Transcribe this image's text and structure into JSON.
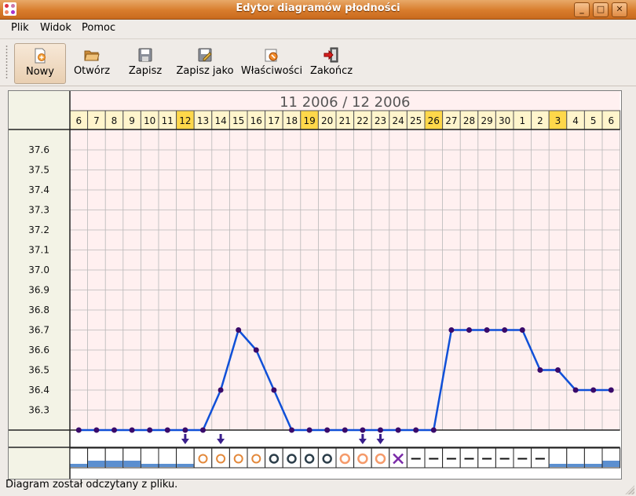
{
  "window": {
    "title": "Edytor diagramów płodności",
    "minimize_glyph": "_",
    "maximize_glyph": "□",
    "close_glyph": "✕"
  },
  "menubar": {
    "items": [
      {
        "label": "Plik"
      },
      {
        "label": "Widok"
      },
      {
        "label": "Pomoc"
      }
    ]
  },
  "toolbar": {
    "buttons": [
      {
        "label": "Nowy",
        "icon": "new-document-icon",
        "active": true
      },
      {
        "label": "Otwórz",
        "icon": "folder-open-icon"
      },
      {
        "label": "Zapisz",
        "icon": "floppy-disk-icon"
      },
      {
        "label": "Zapisz jako",
        "icon": "save-as-icon"
      },
      {
        "label": "Właściwości",
        "icon": "properties-icon"
      },
      {
        "label": "Zakończ",
        "icon": "exit-icon"
      }
    ]
  },
  "chart_data": {
    "type": "line",
    "title": "11 2006 / 12 2006",
    "x": [
      "6",
      "7",
      "8",
      "9",
      "10",
      "11",
      "12",
      "13",
      "14",
      "15",
      "16",
      "17",
      "18",
      "19",
      "20",
      "21",
      "22",
      "23",
      "24",
      "25",
      "26",
      "27",
      "28",
      "29",
      "30",
      "1",
      "2",
      "3",
      "4",
      "5",
      "6"
    ],
    "highlighted_days": [
      6,
      13,
      20,
      27
    ],
    "y_ticks": [
      "37.6",
      "37.5",
      "37.4",
      "37.3",
      "37.2",
      "37.1",
      "37.0",
      "36.9",
      "36.8",
      "36.7",
      "36.6",
      "36.5",
      "36.4",
      "36.3"
    ],
    "ylim": [
      36.2,
      37.7
    ],
    "series": [
      {
        "values": [
          36.2,
          36.2,
          36.2,
          36.2,
          36.2,
          36.2,
          36.2,
          36.2,
          36.4,
          36.7,
          36.6,
          36.4,
          36.2,
          36.2,
          36.2,
          36.2,
          36.2,
          36.2,
          36.2,
          36.2,
          36.2,
          36.7,
          36.7,
          36.7,
          36.7,
          36.7,
          36.5,
          36.5,
          36.4,
          36.4,
          36.4
        ]
      }
    ],
    "markers_arrow_days": [
      6,
      8,
      16,
      17
    ],
    "bleeding_levels": [
      1,
      2,
      2,
      2,
      1,
      1,
      1,
      0,
      0,
      0,
      0,
      0,
      0,
      0,
      0,
      0,
      0,
      0,
      0,
      0,
      0,
      0,
      0,
      0,
      0,
      0,
      0,
      1,
      1,
      1,
      2
    ],
    "symbols": [
      "",
      "",
      "",
      "",
      "",
      "",
      "",
      "circle-orange",
      "circle-orange",
      "circle-orange",
      "circle-orange",
      "circle-dark",
      "circle-dark",
      "circle-dark",
      "circle-dark",
      "circle-light-orange",
      "circle-light-orange",
      "circle-light-orange",
      "cross",
      "dash",
      "dash",
      "dash",
      "dash",
      "dash",
      "dash",
      "dash",
      "dash",
      "",
      "",
      "",
      ""
    ],
    "colors": {
      "line": "#1050d8",
      "point": "#3a0a6a",
      "grid_bg": "#fff0f0",
      "grid_line": "#b8b8b8",
      "header_bg": "#fff5cc",
      "highlight_bg": "#ffd84a",
      "left_panel_bg": "#f3f3e6",
      "arrow": "#3a1f8c",
      "bleeding": "#5b8fd0",
      "circle_orange": "#e3883a",
      "circle_light_orange": "#f59a6a",
      "circle_dark": "#2c3e4a",
      "cross": "#7a2aa8"
    }
  },
  "status": {
    "text": "Diagram został odczytany z pliku."
  }
}
